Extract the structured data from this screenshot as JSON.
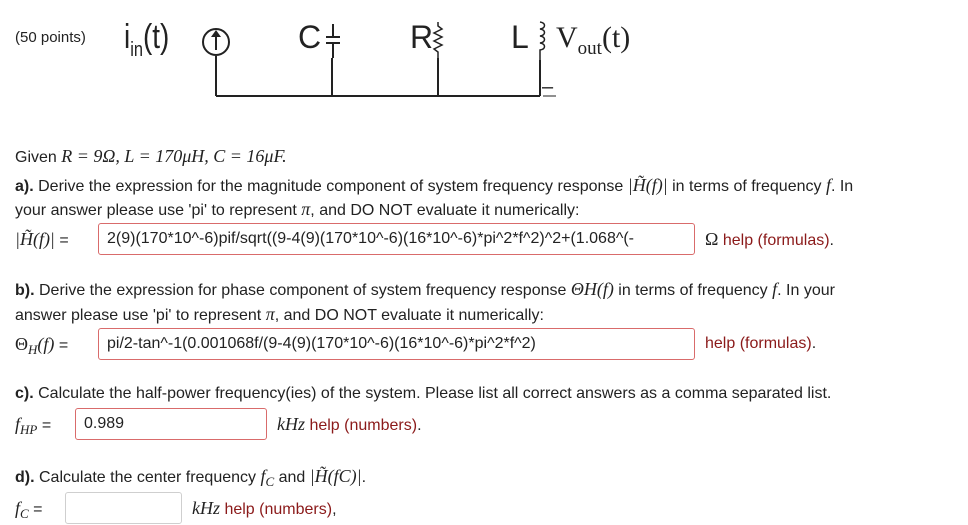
{
  "header": {
    "points": "(50 points)"
  },
  "circuit": {
    "source_label": "i",
    "source_sub": "in",
    "source_arg": "(t)",
    "capacitor": "C",
    "resistor": "R",
    "inductor": "L",
    "output_label": "V",
    "output_sub": "out",
    "output_arg": "(t)",
    "minus_sign": "–"
  },
  "given": {
    "prefix": "Given",
    "math": "R = 9Ω, L = 170μH, C = 16μF."
  },
  "part_a": {
    "label": "a).",
    "text_1": " Derive the expression for the magnitude component of system frequency response ",
    "math_1": "|H̃(f)|",
    "text_2": " in terms of frequency ",
    "math_2": "f",
    "text_3": ". In",
    "text_4": "your answer please use 'pi' to represent ",
    "math_3": "π",
    "text_5": ", and DO NOT evaluate it numerically:",
    "field_label": "|H̃(f)|",
    "eq": "=",
    "value": "2(9)(170*10^-6)pif/sqrt((9-4(9)(170*10^-6)(16*10^-6)*pi^2*f^2)^2+(1.068^(-",
    "unit": "Ω",
    "help": "help (formulas)",
    "help_tail": "."
  },
  "part_b": {
    "label": "b).",
    "text_1": " Derive the expression for phase component of system frequency response ",
    "math_1": "ΘH(f)",
    "text_2": " in terms of frequency ",
    "math_2": "f",
    "text_3": ". In your",
    "text_4": "answer please use 'pi' to represent ",
    "math_3": "π",
    "text_5": ", and DO NOT evaluate it numerically:",
    "field_label_main": "Θ",
    "field_label_sub": "H",
    "field_label_arg": "(f)",
    "eq": "=",
    "value": "pi/2-tan^-1(0.001068f/(9-4(9)(170*10^-6)(16*10^-6)*pi^2*f^2)",
    "help": "help (formulas)",
    "help_tail": "."
  },
  "part_c": {
    "label": "c).",
    "text_1": " Calculate the half-power frequency(ies) of the system. Please list all correct answers as a comma separated list.",
    "field_label_main": "f",
    "field_label_sub": "HP",
    "eq": "=",
    "value": "0.989",
    "unit": "kHz",
    "help": "help (numbers)",
    "help_tail": "."
  },
  "part_d": {
    "label": "d).",
    "text_1": " Calculate the center frequency ",
    "math_1_main": "f",
    "math_1_sub": "C",
    "text_2": " and ",
    "math_2": "|H̃(fC)|",
    "text_3": ".",
    "field_label_main": "f",
    "field_label_sub": "C",
    "eq": "=",
    "value": "",
    "unit": "kHz",
    "help": "help (numbers)",
    "help_tail": ","
  }
}
